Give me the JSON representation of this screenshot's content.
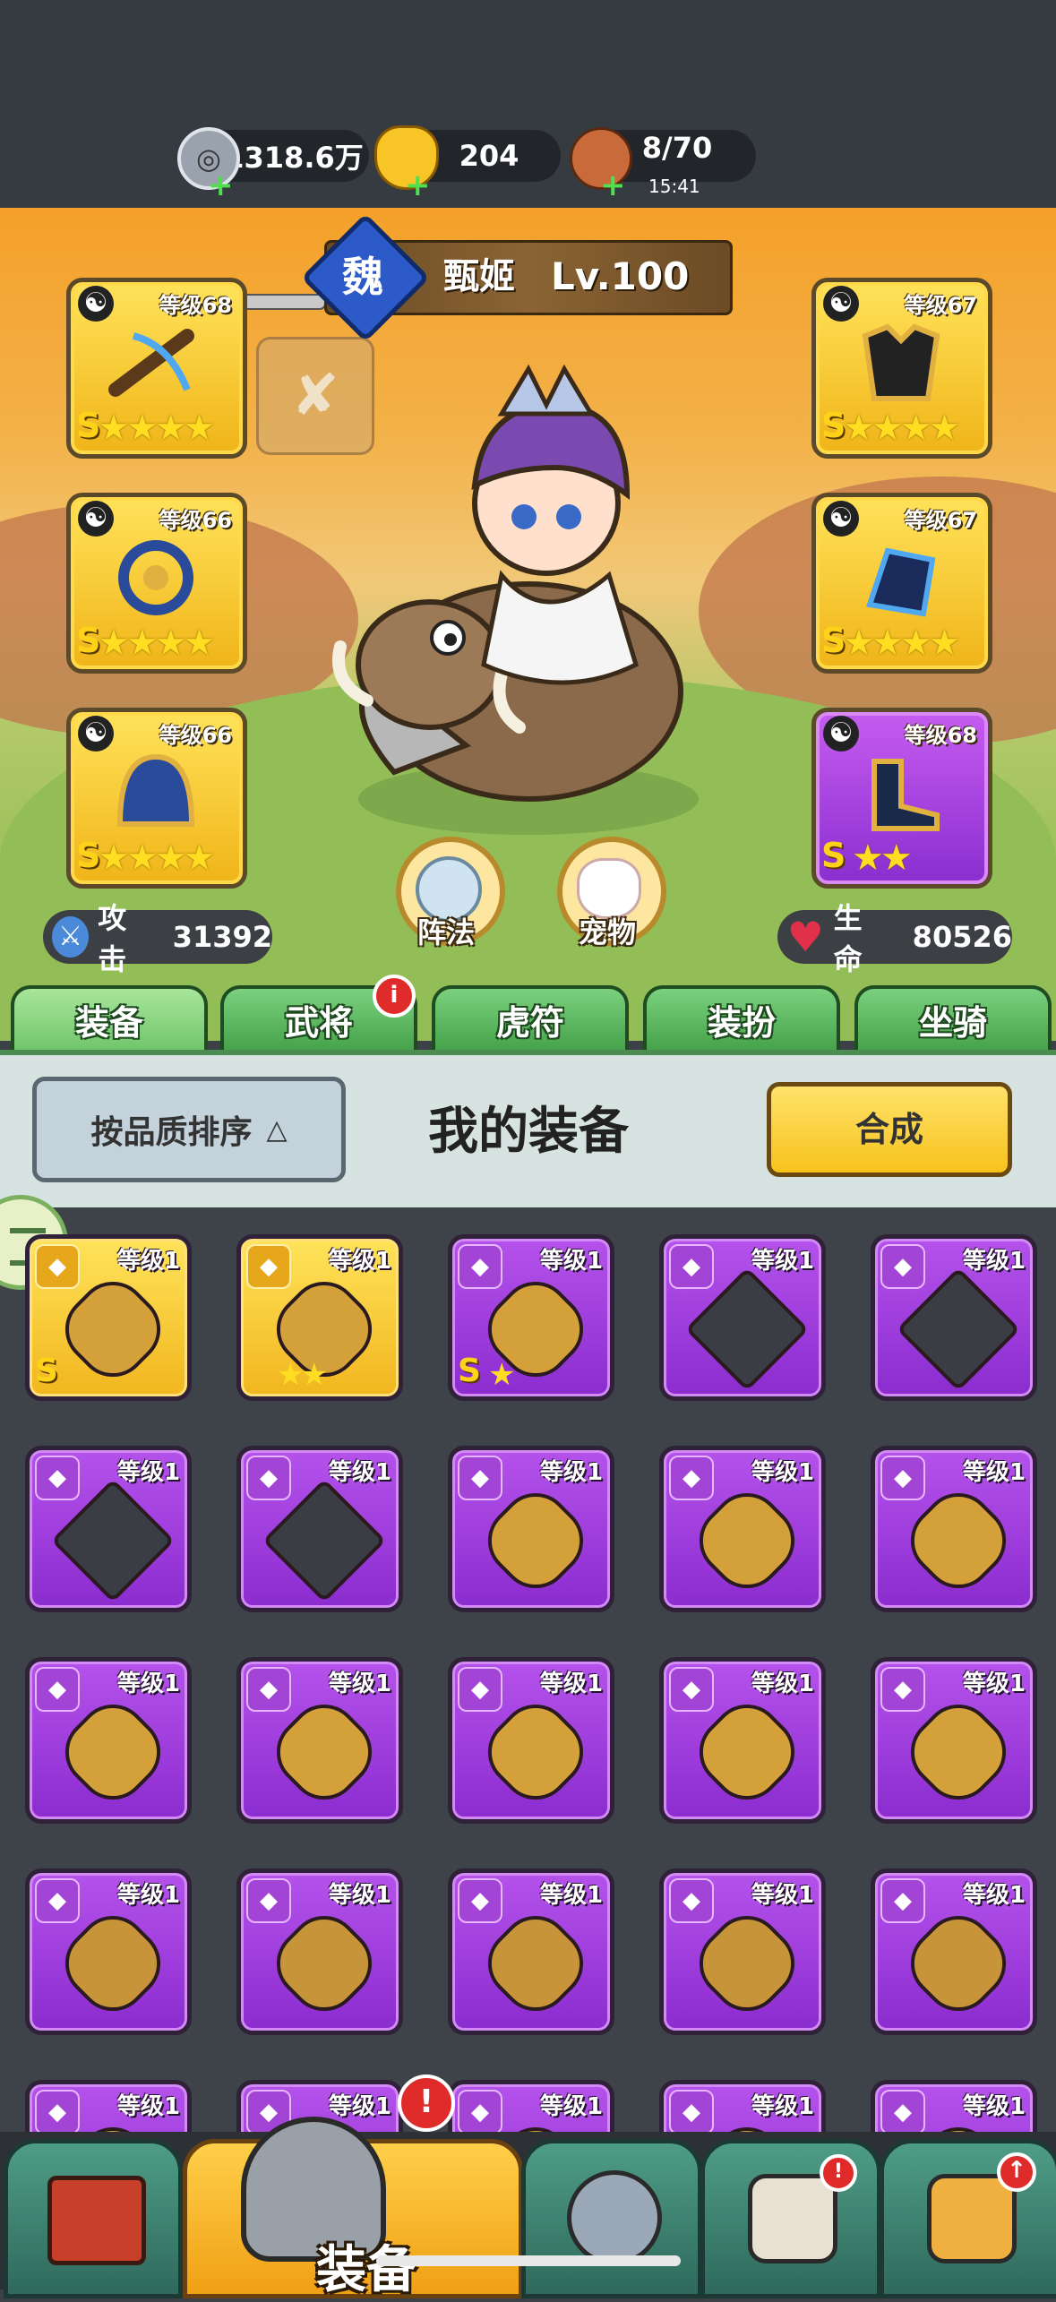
{
  "resources": {
    "coins": "1318.6万",
    "ingots": "204",
    "stamina": "8/70",
    "stamina_timer": "15:41"
  },
  "hero": {
    "faction": "魏",
    "name": "甄姬",
    "level": "Lv.100",
    "attack_label": "攻击",
    "attack_value": "31392",
    "hp_label": "生命",
    "hp_value": "80526",
    "formation_label": "阵法",
    "pet_label": "宠物"
  },
  "equip_slots": [
    {
      "level": "等级68",
      "stars": "★★★★",
      "rank": "S"
    },
    {
      "level": "等级66",
      "stars": "★★★★",
      "rank": "S"
    },
    {
      "level": "等级66",
      "stars": "★★★★",
      "rank": "S"
    },
    {
      "level": "等级67",
      "stars": "★★★★",
      "rank": "S"
    },
    {
      "level": "等级67",
      "stars": "★★★★",
      "rank": "S"
    },
    {
      "level": "等级68",
      "stars": "★★",
      "rank": "S"
    }
  ],
  "tabs": [
    "装备",
    "武将",
    "虎符",
    "装扮",
    "坐骑"
  ],
  "panel": {
    "sort_label": "按品质排序",
    "title": "我的装备",
    "synth_label": "合成"
  },
  "items": [
    {
      "level": "等级1",
      "rank": "S",
      "stars": ""
    },
    {
      "level": "等级1",
      "rank": "",
      "stars": "★★"
    },
    {
      "level": "等级1",
      "rank": "S",
      "stars": "★"
    },
    {
      "level": "等级1",
      "rank": "",
      "stars": ""
    },
    {
      "level": "等级1",
      "rank": "",
      "stars": ""
    },
    {
      "level": "等级1"
    },
    {
      "level": "等级1"
    },
    {
      "level": "等级1"
    },
    {
      "level": "等级1"
    },
    {
      "level": "等级1"
    },
    {
      "level": "等级1"
    },
    {
      "level": "等级1"
    },
    {
      "level": "等级1"
    },
    {
      "level": "等级1"
    },
    {
      "level": "等级1"
    },
    {
      "level": "等级1"
    },
    {
      "level": "等级1"
    },
    {
      "level": "等级1"
    },
    {
      "level": "等级1"
    },
    {
      "level": "等级1"
    },
    {
      "level": "等级1"
    },
    {
      "level": "等级1"
    },
    {
      "level": "等级1"
    },
    {
      "level": "等级1"
    },
    {
      "level": "等级1"
    }
  ],
  "bottom_nav": {
    "active_label": "装备",
    "alert": "!"
  },
  "tab_badge": "i"
}
